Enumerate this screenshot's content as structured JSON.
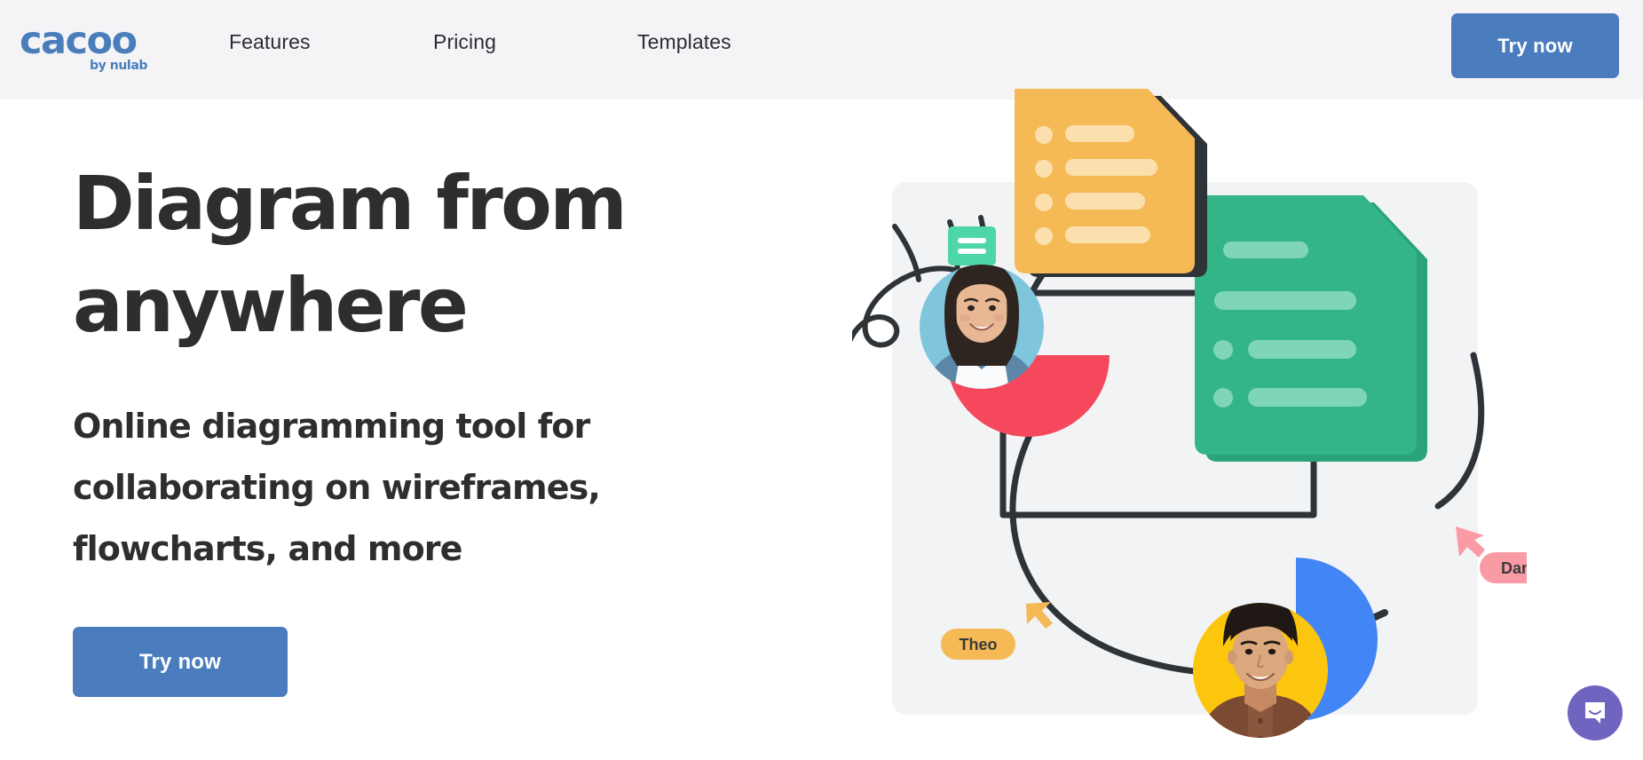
{
  "header": {
    "background_color": "#F4F4F6",
    "logo": {
      "name": "cacoo",
      "tagline": "by nulab",
      "color": "#4A7EBB"
    },
    "nav": [
      {
        "label": "Features"
      },
      {
        "label": "Pricing"
      },
      {
        "label": "Templates"
      }
    ],
    "cta": {
      "label": "Try now",
      "color": "#4A7CBE",
      "text_color": "#FFFFFF"
    }
  },
  "hero": {
    "title": "Diagram from anywhere",
    "subtitle": "Online diagramming tool for collaborating on wireframes, flowcharts, and more",
    "cta": {
      "label": "Try now",
      "color": "#4A7CBE",
      "text_color": "#FFFFFF"
    },
    "title_color": "#2E2E2E"
  },
  "illustration": {
    "panel_color": "#F2F3F5",
    "cursors": [
      {
        "name": "Theo",
        "pill_color": "#F5B955",
        "cursor_color": "#F5B955",
        "text_color": "#3A3A3A"
      },
      {
        "name": "Daniele",
        "pill_color": "#FA9AA5",
        "cursor_color": "#FA9AA5",
        "text_color": "#3A3A3A"
      }
    ],
    "cards": [
      {
        "id": "orange-document-card",
        "color": "#F5B955",
        "line_color": "#FBE0AE",
        "shadow_color": "#2E3338",
        "rows": 4
      },
      {
        "id": "green-document-card",
        "color": "#33B588",
        "line_color": "#7FD6B6",
        "outline_color": "#2E3338",
        "rows": 4
      }
    ],
    "avatars": [
      {
        "id": "avatar-woman",
        "ring_color": "#7FC5DC",
        "accent_color": "#F6485D",
        "accent_shape": "half-circle"
      },
      {
        "id": "avatar-man",
        "ring_color": "#FBC60D",
        "accent_color": "#4285F4",
        "accent_shape": "half-circle"
      }
    ],
    "speech_bubble": {
      "color": "#4FD6A8",
      "line_color": "#FFFFFF",
      "lines": 2
    },
    "connector_color": "#2E3338"
  },
  "chat_widget": {
    "icon": "chat-bubble-icon",
    "color": "#6F65C0",
    "icon_color": "#FFFFFF"
  }
}
